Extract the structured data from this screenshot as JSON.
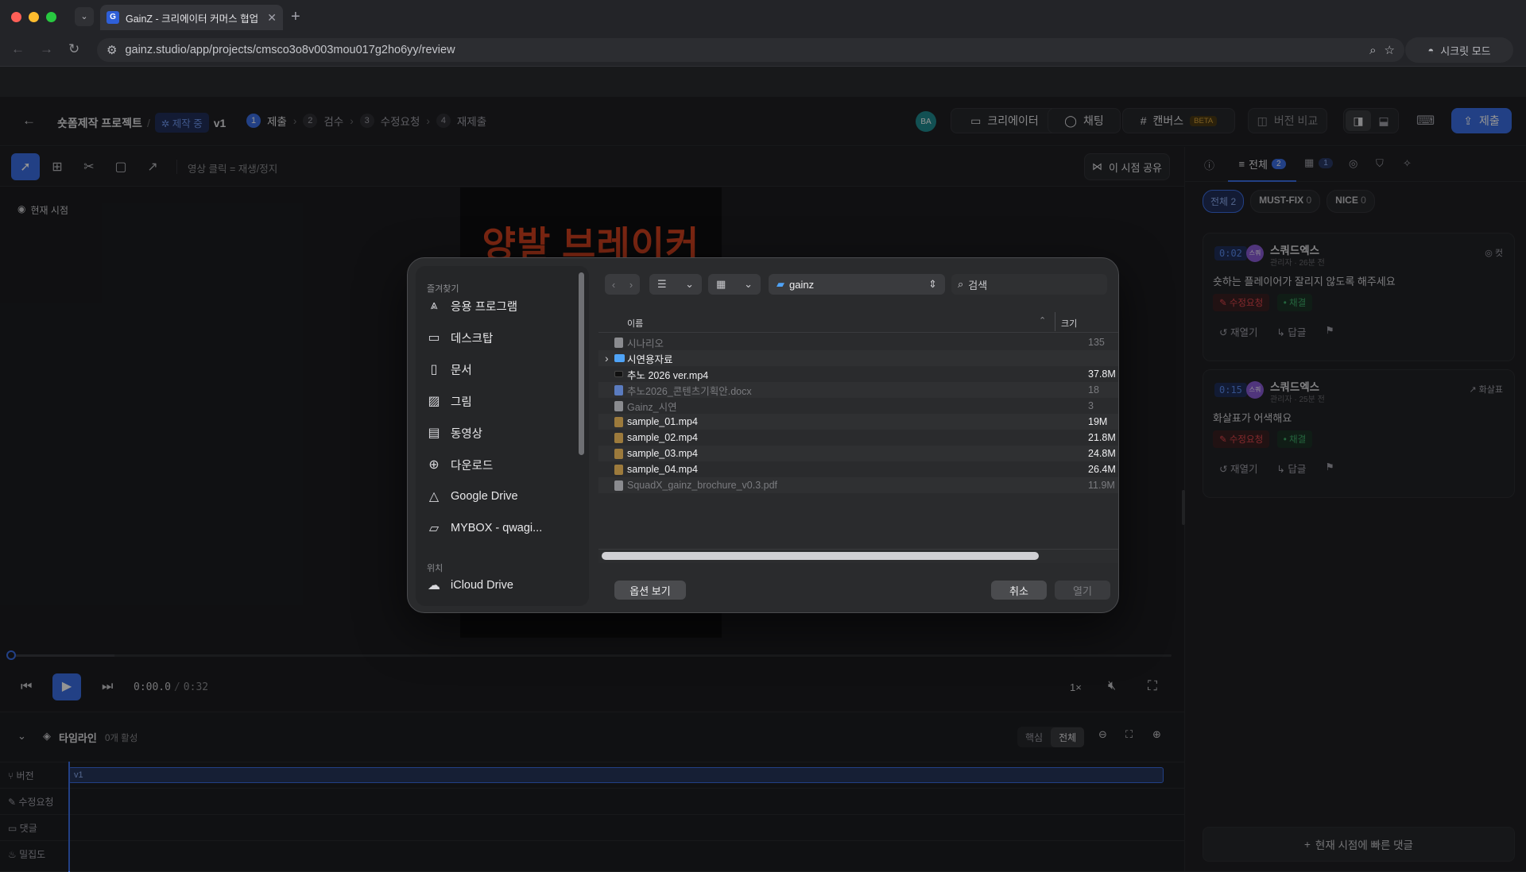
{
  "browser": {
    "tab_title": "GainZ - 크리에이터 커머스 협업 (",
    "tab_favicon_letter": "G",
    "url": "gainz.studio/app/projects/cmsco3o8v003mou017g2ho6yy/review",
    "incognito_label": "시크릿 모드"
  },
  "header": {
    "project": "숏폼제작 프로젝트",
    "separator": "/",
    "status_badge": "제작 중",
    "version": "v1",
    "steps": [
      {
        "num": "1",
        "label": "제출"
      },
      {
        "num": "2",
        "label": "검수"
      },
      {
        "num": "3",
        "label": "수정요청"
      },
      {
        "num": "4",
        "label": "재제출"
      }
    ],
    "avatar_initials": "BA",
    "creator_btn": "크리에이터",
    "chat_btn": "채팅",
    "canvas_btn": "캔버스",
    "canvas_badge": "BETA",
    "compare_btn": "버전 비교",
    "submit_btn": "제출"
  },
  "toolbar": {
    "hint": "영상 클릭 = 재생/정지",
    "share_btn": "이 시점 공유"
  },
  "stage": {
    "current_view": "현재 시점",
    "video_title_text": "양발 브레이커"
  },
  "player": {
    "current_time": "0:00.0",
    "separator": "/",
    "duration": "0:32",
    "speed": "1×"
  },
  "timeline": {
    "title": "타임라인",
    "active_count": "0개 활성",
    "toggle_core": "핵심",
    "toggle_all": "전체",
    "rows": [
      {
        "label": "버전",
        "value": "v1"
      },
      {
        "label": "수정요청",
        "value": ""
      },
      {
        "label": "댓글",
        "value": ""
      },
      {
        "label": "밀집도",
        "value": ""
      }
    ]
  },
  "panel": {
    "tab_all": "전체",
    "tab_all_count": "2",
    "tab_scene_count": "1",
    "filters": [
      {
        "label": "전체",
        "count": "2"
      },
      {
        "label": "MUST-FIX",
        "count": "0"
      },
      {
        "label": "NICE",
        "count": "0"
      }
    ],
    "comments": [
      {
        "time": "0:02",
        "avatar": "스쿼",
        "author": "스쿼드엑스",
        "meta": "관리자 · 26분 전",
        "category": "컷",
        "body": "숏하는 플레이어가 잘리지 않도록 해주세요",
        "tag_fix": "수정요청",
        "tag_adopt": "채결",
        "reopen": "재열기",
        "reply": "답글"
      },
      {
        "time": "0:15",
        "avatar": "스쿼",
        "author": "스쿼드엑스",
        "meta": "관리자 · 25분 전",
        "category": "화살표",
        "body": "화살표가 어색해요",
        "tag_fix": "수정요청",
        "tag_adopt": "채결",
        "reopen": "재열기",
        "reply": "답글"
      }
    ],
    "quick_comment": "현재 시점에 빠른 댓글"
  },
  "dialog": {
    "favorites_header": "즐겨찾기",
    "favorites": [
      {
        "icon": "apps-icon",
        "label": "응용 프로그램"
      },
      {
        "icon": "desktop-icon",
        "label": "데스크탑"
      },
      {
        "icon": "document-icon",
        "label": "문서"
      },
      {
        "icon": "pictures-icon",
        "label": "그림"
      },
      {
        "icon": "movies-icon",
        "label": "동영상"
      },
      {
        "icon": "download-icon",
        "label": "다운로드"
      },
      {
        "icon": "google-drive-icon",
        "label": "Google Drive"
      },
      {
        "icon": "folder-icon",
        "label": "MYBOX - qwagi..."
      }
    ],
    "locations_header": "위치",
    "locations": [
      {
        "icon": "icloud-icon",
        "label": "iCloud Drive"
      }
    ],
    "current_folder": "gainz",
    "search_placeholder": "검색",
    "col_name": "이름",
    "col_size": "크기",
    "files": [
      {
        "name": "시나리오",
        "size": "135",
        "type": "doc",
        "enabled": false,
        "expand": false
      },
      {
        "name": "시연용자료",
        "size": "",
        "type": "folder",
        "enabled": true,
        "expand": true
      },
      {
        "name": "추노 2026 ver.mp4",
        "size": "37.8M",
        "type": "video-dark",
        "enabled": true,
        "expand": false
      },
      {
        "name": "추노2026_콘텐츠기획안.docx",
        "size": "18",
        "type": "docx",
        "enabled": false,
        "expand": false
      },
      {
        "name": "Gainz_시연",
        "size": "3",
        "type": "doc",
        "enabled": false,
        "expand": false
      },
      {
        "name": "sample_01.mp4",
        "size": "19M",
        "type": "video",
        "enabled": true,
        "expand": false
      },
      {
        "name": "sample_02.mp4",
        "size": "21.8M",
        "type": "video",
        "enabled": true,
        "expand": false
      },
      {
        "name": "sample_03.mp4",
        "size": "24.8M",
        "type": "video",
        "enabled": true,
        "expand": false
      },
      {
        "name": "sample_04.mp4",
        "size": "26.4M",
        "type": "video",
        "enabled": true,
        "expand": false
      },
      {
        "name": "SquadX_gainz_brochure_v0.3.pdf",
        "size": "11.9M",
        "type": "pdf",
        "enabled": false,
        "expand": false
      }
    ],
    "options_btn": "옵션 보기",
    "cancel_btn": "취소",
    "open_btn": "열기"
  },
  "colors": {
    "accent": "#3b6ee6",
    "video_title": "#d4421f",
    "fix_tag": "#e5484d",
    "adopt_tag": "#3fae6a",
    "beta_badge": "#d9a23a"
  }
}
